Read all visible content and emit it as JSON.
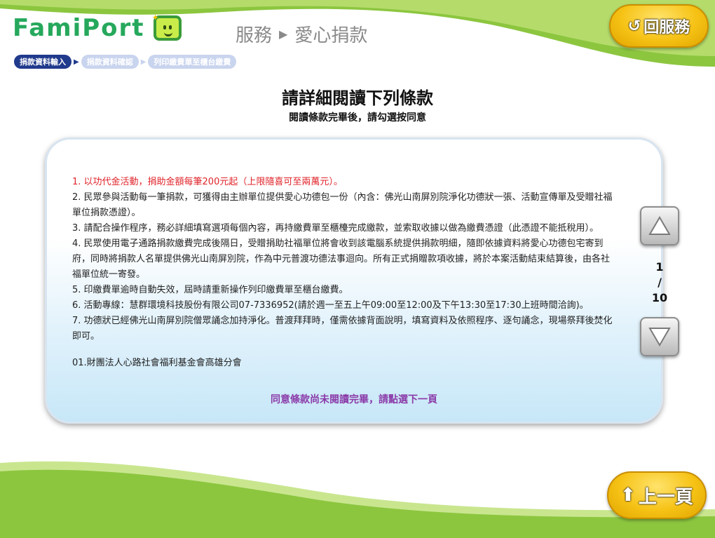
{
  "header": {
    "logo_text": "FamiPort",
    "service_label": "服務",
    "service_sub": "愛心捐款",
    "back_button": "回服務"
  },
  "steps": [
    "捐款資料輸入",
    "捐款資料確認",
    "列印繳費單至櫃台繳費"
  ],
  "title": "請詳細閱讀下列條款",
  "subtitle": "閱讀條款完畢後，請勾選按同意",
  "terms": [
    "1. 以功代金活動，捐助金額每筆200元起（上限隨喜可至兩萬元）。",
    "2. 民眾參與活動每一筆捐款，可獲得由主辦單位提供愛心功德包一份（內含：佛光山南屏別院淨化功德狀一張、活動宣傳單及受贈社福單位捐款憑證）。",
    "3. 請配合操作程序，務必詳細填寫選項每個內容，再持繳費單至櫃檯完成繳款，並索取收據以做為繳費憑證（此憑證不能抵稅用）。",
    "4. 民眾使用電子通路捐款繳費完成後隔日，受贈捐助社福單位將會收到該電腦系統提供捐款明細，隨即依據資料將愛心功德包宅寄到府，同時將捐款人名單提供佛光山南屏別院，作為中元普渡功德法事迴向。所有正式捐贈款項收據，將於本案活動結束結算後，由各社福單位統一寄發。",
    "5. 印繳費單逾時自動失效，屆時請重新操作列印繳費單至櫃台繳費。",
    "6. 活動專線：慧群環境科技股份有限公司07-7336952(請於週一至五上午09:00至12:00及下午13:30至17:30上班時間洽詢)。",
    "7. 功德狀已經佛光山南屏別院僧眾誦念加持淨化。普渡拜拜時，僅需依據背面說明，填寫資料及依照程序、逐句誦念，現場祭拜後焚化即可。"
  ],
  "organization": "01.財團法人心路社會福利基金會高雄分會",
  "notice": "同意條款尚未閱讀完畢，請點選下一頁",
  "pager": {
    "current": "1",
    "separator": "/",
    "total": "10"
  },
  "footer": {
    "prev_button": "上一頁"
  },
  "colors": {
    "accent_green": "#8cc63f",
    "step_active": "#203a8c",
    "notice": "#8a3aa8",
    "first_term": "#e0242a"
  },
  "icons": {
    "back": "rotate-left-icon",
    "prev": "arrow-up-icon",
    "page_up": "triangle-up-icon",
    "page_down": "triangle-down-icon"
  }
}
